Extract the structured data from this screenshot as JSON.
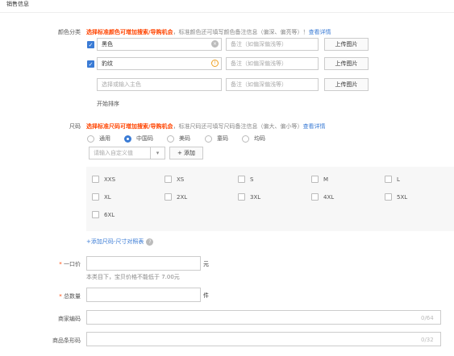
{
  "section_title": "销售信息",
  "color": {
    "label": "颜色分类",
    "tip_warn": "选择标准颜色可增加搜索/导购机会",
    "tip_text": "，标准颜色还可填写颜色备注信息（偏深、偏亮等）！",
    "tip_link": "查看详情",
    "rows": [
      {
        "checked": true,
        "value": "黑色",
        "placeholder": "",
        "note_placeholder": "备注（如偏深偏浅等）",
        "upload": "上传图片",
        "icon": "clear-icon"
      },
      {
        "checked": true,
        "value": "豹纹",
        "placeholder": "",
        "note_placeholder": "备注（如偏深偏浅等）",
        "upload": "上传图片",
        "icon": "warning-icon"
      },
      {
        "checked": false,
        "value": "",
        "placeholder": "选择或输入主色",
        "note_placeholder": "备注（如偏深偏浅等）",
        "upload": "上传图片",
        "icon": ""
      }
    ],
    "sort": "开始排序"
  },
  "size": {
    "label": "尺码",
    "tip_warn": "选择标准尺码可增加搜索/导购机会",
    "tip_text": "，标准尺码还可填写尺码备注信息（偏大、偏小等）",
    "tip_link": "查看详情",
    "radios": [
      {
        "label": "通用",
        "selected": false
      },
      {
        "label": "中国码",
        "selected": true
      },
      {
        "label": "美码",
        "selected": false
      },
      {
        "label": "童码",
        "selected": false
      },
      {
        "label": "均码",
        "selected": false
      }
    ],
    "custom_placeholder": "请输入自定义值",
    "add_label": "+ 添加",
    "options": [
      "XXS",
      "XS",
      "S",
      "M",
      "L",
      "XL",
      "2XL",
      "3XL",
      "4XL",
      "5XL",
      "6XL"
    ],
    "add_size_link": "+添加尺码-尺寸对照表"
  },
  "price": {
    "label": "一口价",
    "unit": "元",
    "hint": "本类目下，宝贝价格不能低于 7.00元"
  },
  "quantity": {
    "label": "总数量",
    "unit": "件"
  },
  "merchant_code": {
    "label": "商家编码",
    "counter": "0/64"
  },
  "barcode": {
    "label": "商品条形码",
    "counter": "0/32"
  }
}
